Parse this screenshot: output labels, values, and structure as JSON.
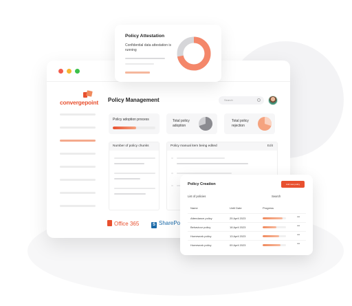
{
  "colors": {
    "accent": "#e8502f",
    "accent_light": "#f5a37f",
    "sharepoint": "#1b6aa8"
  },
  "brand": {
    "logo_text": "convergepoint",
    "logo_icon": "convergepoint-logo-icon"
  },
  "header": {
    "title": "Policy Management",
    "search_placeholder": "Search"
  },
  "cards": {
    "adoption": {
      "label": "Policy adoption process",
      "progress": 0.55
    },
    "total_adoption": {
      "label": "Total policy adoption",
      "progress": 0.7
    },
    "total_rejection": {
      "label": "Total policy rejection",
      "progress": 0.3
    }
  },
  "panels": {
    "chunks": {
      "title": "Number of policy chunks"
    },
    "manual": {
      "title": "Policy manual item being edited",
      "edit_label": "Edit"
    }
  },
  "integrations": {
    "office": "Office 365",
    "sharepoint": "SharePo"
  },
  "attestation": {
    "title": "Policy Attestation",
    "description": "Confidential data attestation is running",
    "progress": 0.72
  },
  "creation": {
    "title": "Policy Creation",
    "button_label": "Add new policy",
    "list_label": "List of policies",
    "search_label": "Search",
    "columns": [
      "Name",
      "Until Date",
      "Progress"
    ],
    "rows": [
      {
        "name": "Attendance policy",
        "date": "25 April 2023",
        "progress": 0.85
      },
      {
        "name": "Behaviour policy",
        "date": "18 April 2023",
        "progress": 0.6
      },
      {
        "name": "Homework policy",
        "date": "13 April 2023",
        "progress": 0.7
      },
      {
        "name": "Homework policy",
        "date": "09 April 2023",
        "progress": 0.75
      }
    ]
  }
}
